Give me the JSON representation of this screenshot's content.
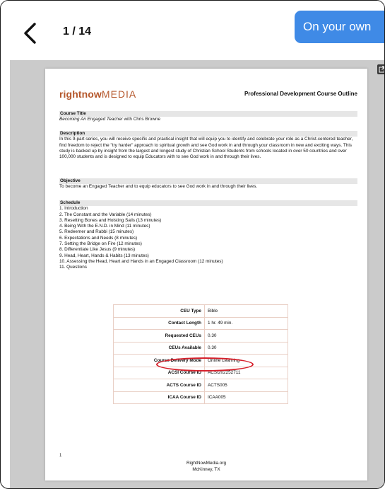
{
  "topbar": {
    "page_counter": "1 / 14",
    "mode_button": "On your own"
  },
  "document": {
    "logo_bold": "rightnow",
    "logo_light": "MEDIA",
    "header_title": "Professional Development Course Outline",
    "course_title_label": "Course Title",
    "course_title_italic": "Becoming An Engaged Teacher",
    "course_title_rest": " with Chris Browne",
    "description_label": "Description",
    "description_text": "In this 9-part series, you will receive specific and practical insight that will equip you to identify and celebrate your role as a Christ-centered teacher, find freedom to reject the \"try harder\" approach to spiritual growth and see God work in and through your classroom in new and exciting ways. This study is backed up by insight from the largest and longest study of Christian School Students from schools located in over 50 countries and over 100,000 students and is designed to equip Educators with to see God work in and through their lives.",
    "objective_label": "Objective",
    "objective_text": "To become an Engaged Teacher and to equip educators to see God work in and through their lives.",
    "schedule_label": "Schedule",
    "schedule": [
      "1.  Introduction",
      "2.  The Constant and the Variable (14 minutes)",
      "3.  Resetting Bones and Hoisting Sails (13 minutes)",
      "4.  Being With the E.N.D. in Mind (11 minutes)",
      "5.  Redeemer and Rabbi (15 minutes)",
      "6.  Expectations and Needs (8 minutes)",
      "7.  Setting the Bridge on Fire (12 minutes)",
      "8.  Differentiate Like Jesus (9 minutes)",
      "9.  Head, Heart, Hands & Habits (13 minutes)",
      "10. Assessing the Head, Heart and Hands in an Engaged Classroom (12 minutes)",
      "11. Questions"
    ],
    "ceu_table": [
      {
        "label": "CEU Type",
        "value": "Bible"
      },
      {
        "label": "Contact Length",
        "value": "1 hr. 49 min."
      },
      {
        "label": "Requested CEUs",
        "value": "0.30"
      },
      {
        "label": "CEUs Available",
        "value": "0.30"
      },
      {
        "label": "Course Delivery Mode",
        "value": "Online Learning"
      },
      {
        "label": "ACSI Course ID",
        "value": "ACSI202252711"
      },
      {
        "label": "ACTS Course ID",
        "value": "ACTS005"
      },
      {
        "label": "ICAA Course ID",
        "value": "ICAA005"
      }
    ],
    "page_number": "1",
    "footer_line1": "RightNowMedia.org",
    "footer_line2": "McKinney, TX"
  },
  "colors": {
    "accent": "#3f8ae6",
    "brand": "#b5572b",
    "highlight": "#d61f2a"
  }
}
